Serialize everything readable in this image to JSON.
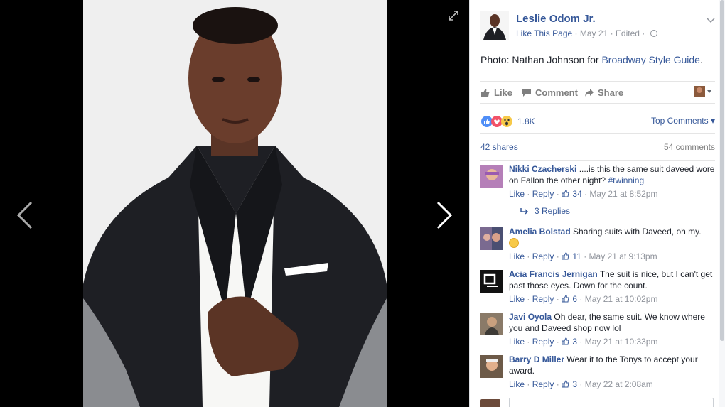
{
  "post": {
    "page_name": "Leslie Odom Jr.",
    "like_page": "Like This Page",
    "date": "May 21",
    "edited": "Edited",
    "caption_prefix": "Photo: Nathan Johnson for ",
    "caption_link": "Broadway Style Guide",
    "caption_suffix": "."
  },
  "actions": {
    "like": "Like",
    "comment": "Comment",
    "share": "Share"
  },
  "stats": {
    "reaction_count": "1.8K",
    "top_comments": "Top Comments",
    "shares": "42 shares",
    "comments": "54 comments"
  },
  "comments": [
    {
      "author": "Nikki Czacherski",
      "text": " ....is this the same suit daveed wore on Fallon the other night? ",
      "tag": "#twinning",
      "like": "Like",
      "reply": "Reply",
      "likes": "34",
      "time": "May 21 at 8:52pm",
      "replies": "3 Replies"
    },
    {
      "author": "Amelia Bolstad",
      "text": " Sharing suits with Daveed, oh my.",
      "like": "Like",
      "reply": "Reply",
      "likes": "11",
      "time": "May 21 at 9:13pm"
    },
    {
      "author": "Acia Francis Jernigan",
      "text": " The suit is nice, but I can't get past those eyes. Down for the count.",
      "like": "Like",
      "reply": "Reply",
      "likes": "6",
      "time": "May 21 at 10:02pm"
    },
    {
      "author": "Javi Oyola",
      "text": " Oh dear, the same suit. We know where you and Daveed shop now lol",
      "like": "Like",
      "reply": "Reply",
      "likes": "3",
      "time": "May 21 at 10:33pm"
    },
    {
      "author": "Barry D Miller",
      "text": " Wear it to the Tonys to accept your award.",
      "like": "Like",
      "reply": "Reply",
      "likes": "3",
      "time": "May 22 at 2:08am"
    }
  ]
}
